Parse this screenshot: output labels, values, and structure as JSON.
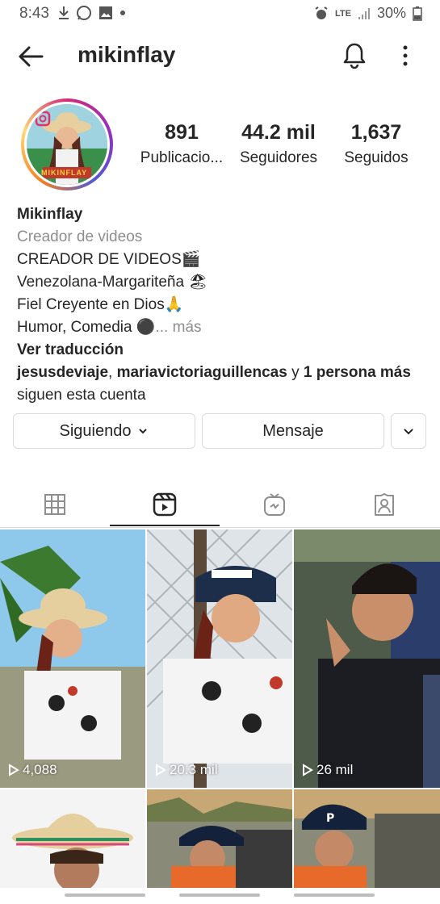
{
  "status_bar": {
    "time": "8:43",
    "battery": "30%",
    "network": "LTE"
  },
  "header": {
    "username": "mikinflay"
  },
  "profile": {
    "avatar_text": "MIKINFLAY",
    "stats": [
      {
        "value": "891",
        "label": "Publicacio..."
      },
      {
        "value": "44.2 mil",
        "label": "Seguidores"
      },
      {
        "value": "1,637",
        "label": "Seguidos"
      }
    ],
    "name": "Mikinflay",
    "category": "Creador de videos",
    "bio_lines": [
      "CREADOR DE VIDEOS🎬",
      "Venezolana-Margariteña 🏖",
      "Fiel Creyente en Dios🙏",
      "Humor, Comedia ⚫"
    ],
    "more_label": "... más",
    "translate_label": "Ver traducción",
    "followed_by_1": "jesusdeviaje",
    "followed_by_2": "mariavictoriaguillencas",
    "followed_by_and": "y",
    "followed_by_more": "1 persona más",
    "followed_by_suffix": "siguen esta cuenta"
  },
  "actions": {
    "following_label": "Siguiendo",
    "message_label": "Mensaje"
  },
  "tabs": [
    "grid",
    "reels",
    "igtv",
    "tagged"
  ],
  "reels": [
    {
      "views": "4,088"
    },
    {
      "views": "20.3 mil"
    },
    {
      "views": "26 mil"
    },
    {
      "views": ""
    },
    {
      "views": ""
    },
    {
      "views": ""
    }
  ],
  "colors": {
    "text": "#262626",
    "secondary": "#8e8e8e",
    "border": "#dbdbdb"
  }
}
